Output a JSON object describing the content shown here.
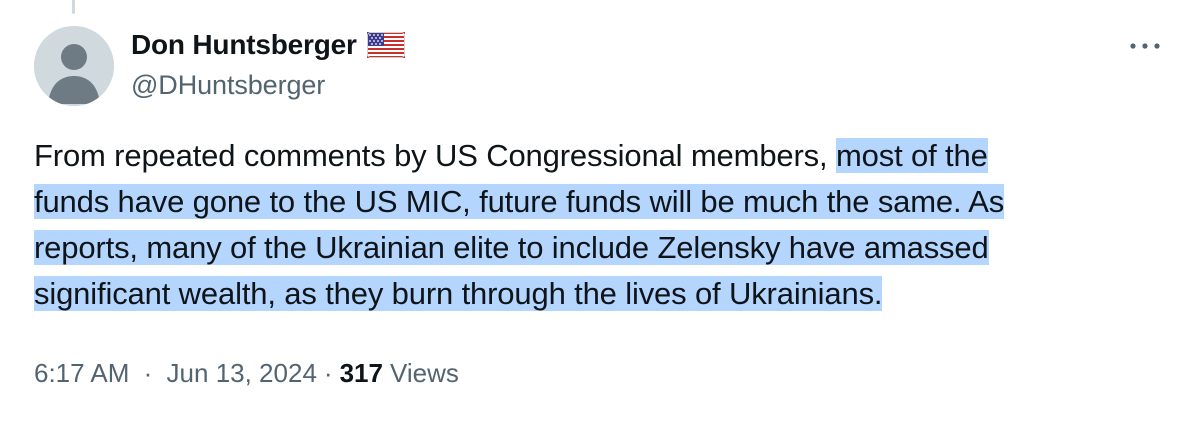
{
  "author": {
    "display_name": "Don Huntsberger",
    "handle": "@DHuntsberger",
    "flag_icon": "us-flag-icon",
    "avatar_icon": "default-avatar-icon"
  },
  "more_icon": "more-horizontal-icon",
  "tweet": {
    "text_plain": "From repeated comments by US Congressional members, ",
    "text_selected_line1": "most of the",
    "text_selected_line2": "funds have gone to the US MIC, future funds will be much the same. As",
    "text_selected_line3": "reports, many of the Ukrainian elite to include Zelensky have amassed",
    "text_selected_line4": "significant wealth, as they burn through the lives of Ukrainians."
  },
  "meta": {
    "time": "6:17 AM",
    "separator": "·",
    "date": "Jun 13, 2024",
    "views_count": "317",
    "views_label": "Views"
  },
  "colors": {
    "selection": "#b4d5fe",
    "secondary_text": "#536471",
    "primary_text": "#0f1419"
  }
}
